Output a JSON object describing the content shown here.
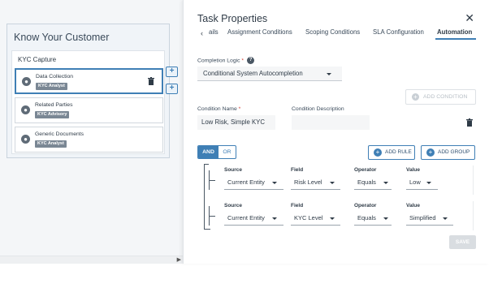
{
  "kyc": {
    "title": "Know Your Customer",
    "capture_title": "KYC Capture",
    "steps": [
      {
        "name": "Data Collection",
        "tag": "KYC Analyst"
      },
      {
        "name": "Related Parties",
        "tag": "KYC Advisory"
      },
      {
        "name": "Generic Documents",
        "tag": "KYC Analyst"
      }
    ]
  },
  "drawer": {
    "title": "Task Properties",
    "close_icon": "close-icon",
    "tabs": [
      "ails",
      "Assignment Conditions",
      "Scoping Conditions",
      "SLA Configuration",
      "Automation"
    ],
    "active_tab": "Automation",
    "completion_logic_label": "Completion Logic",
    "completion_logic_value": "Conditional System Autocompletion",
    "add_condition_label": "ADD CONDITION",
    "condition_name_label": "Condition Name",
    "condition_name_value": "Low Risk, Simple KYC",
    "condition_desc_label": "Condition Description",
    "condition_desc_value": "",
    "and_label": "AND",
    "or_label": "OR",
    "add_rule_label": "ADD RULE",
    "add_group_label": "ADD GROUP",
    "rules_headers": {
      "source": "Source",
      "field": "Field",
      "operator": "Operator",
      "value": "Value"
    },
    "rules": [
      {
        "source": "Current Entity",
        "field": "Risk Level",
        "operator": "Equals",
        "value": "Low"
      },
      {
        "source": "Current Entity",
        "field": "KYC Level",
        "operator": "Equals",
        "value": "Simplified"
      }
    ],
    "save_label": "SAVE"
  },
  "colors": {
    "accent": "#3f7fb5",
    "required": "#d0392f"
  }
}
